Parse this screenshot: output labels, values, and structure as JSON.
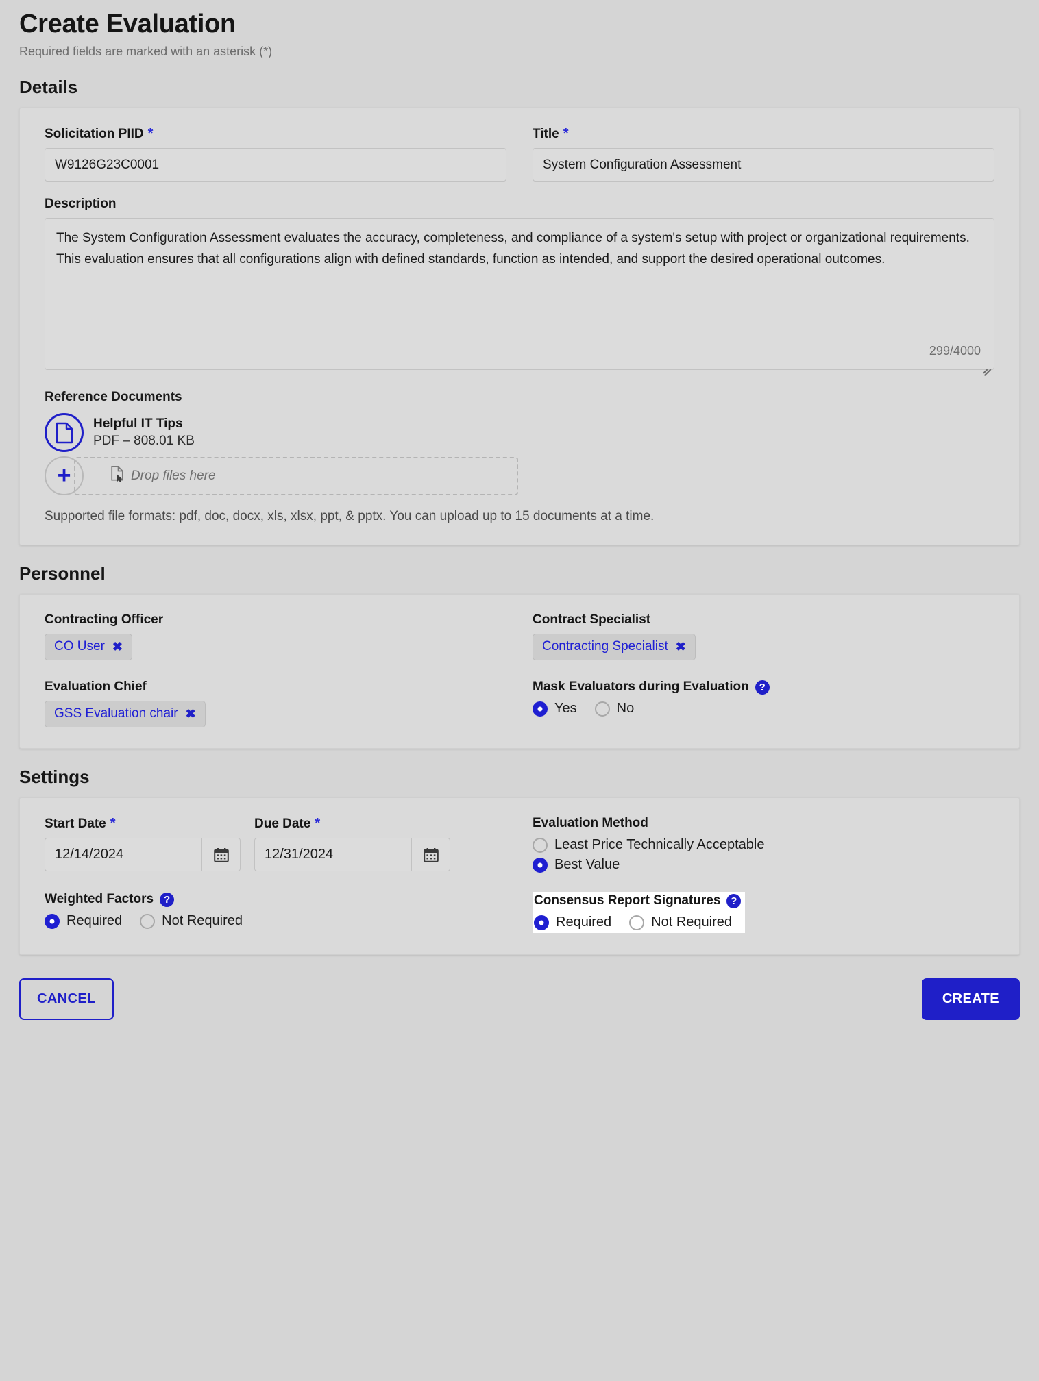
{
  "header": {
    "title": "Create Evaluation",
    "subtitle": "Required fields are marked with an asterisk (*)"
  },
  "sections": {
    "details": "Details",
    "personnel": "Personnel",
    "settings": "Settings"
  },
  "details": {
    "solicitation_piid": {
      "label": "Solicitation PIID",
      "required_marker": "*",
      "value": "W9126G23C0001"
    },
    "title_field": {
      "label": "Title",
      "required_marker": "*",
      "value": "System Configuration Assessment"
    },
    "description": {
      "label": "Description",
      "value": "The System Configuration Assessment evaluates the accuracy, completeness, and compliance of a system's setup with project or organizational requirements. This evaluation ensures that all configurations align with defined standards, function as intended, and support the desired operational outcomes.",
      "char_count": "299/4000"
    },
    "reference_documents": {
      "label": "Reference Documents",
      "files": [
        {
          "name": "Helpful IT Tips",
          "meta": "PDF – 808.01 KB",
          "icon": "pdf-document-icon"
        }
      ],
      "add_button_glyph": "+",
      "dropzone_text": "Drop files here",
      "dropzone_icon": "file-cursor-icon",
      "formats_note": "Supported file formats: pdf, doc, docx, xls, xlsx, ppt, & pptx. You can upload up to 15 documents at a time."
    }
  },
  "personnel": {
    "contracting_officer": {
      "label": "Contracting Officer",
      "chip": "CO User",
      "remove_glyph": "✖"
    },
    "contract_specialist": {
      "label": "Contract Specialist",
      "chip": "Contracting Specialist",
      "remove_glyph": "✖"
    },
    "evaluation_chief": {
      "label": "Evaluation Chief",
      "chip": "GSS Evaluation chair",
      "remove_glyph": "✖"
    },
    "mask_evaluators": {
      "label": "Mask Evaluators during Evaluation",
      "help_glyph": "?",
      "options": [
        {
          "label": "Yes",
          "selected": true
        },
        {
          "label": "No",
          "selected": false
        }
      ]
    }
  },
  "settings": {
    "start_date": {
      "label": "Start Date",
      "required_marker": "*",
      "value": "12/14/2024",
      "picker_icon": "calendar-icon"
    },
    "due_date": {
      "label": "Due Date",
      "required_marker": "*",
      "value": "12/31/2024",
      "picker_icon": "calendar-icon"
    },
    "evaluation_method": {
      "label": "Evaluation Method",
      "options": [
        {
          "label": "Least Price Technically Acceptable",
          "selected": false
        },
        {
          "label": "Best Value",
          "selected": true
        }
      ]
    },
    "weighted_factors": {
      "label": "Weighted Factors",
      "help_glyph": "?",
      "options": [
        {
          "label": "Required",
          "selected": true
        },
        {
          "label": "Not Required",
          "selected": false
        }
      ]
    },
    "consensus_report_signatures": {
      "label": "Consensus Report Signatures",
      "help_glyph": "?",
      "highlighted": true,
      "options": [
        {
          "label": "Required",
          "selected": true
        },
        {
          "label": "Not Required",
          "selected": false
        }
      ]
    }
  },
  "footer": {
    "cancel_label": "CANCEL",
    "create_label": "CREATE"
  },
  "colors": {
    "accent_blue": "#1f1fc8",
    "page_bg": "#d5d5d5",
    "card_bg": "#dadada"
  }
}
